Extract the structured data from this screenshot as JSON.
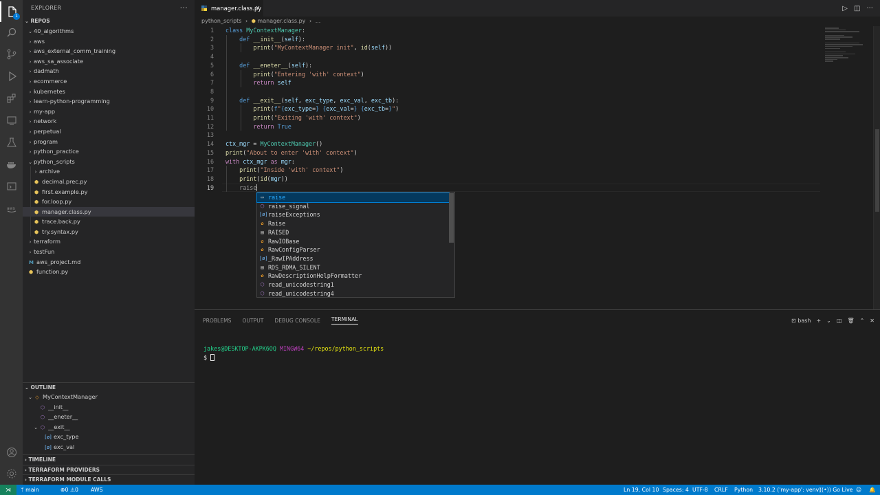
{
  "colors": {
    "accent": "#007acc",
    "remote": "#16825d",
    "selection": "#04395e"
  },
  "sidebar": {
    "title": "EXPLORER",
    "repos_label": "REPOS",
    "tree": [
      {
        "label": "40_algorithms",
        "type": "folder",
        "level": 1,
        "open": true
      },
      {
        "label": "aws",
        "type": "folder",
        "level": 1
      },
      {
        "label": "aws_external_comm_training",
        "type": "folder",
        "level": 1
      },
      {
        "label": "aws_sa_associate",
        "type": "folder",
        "level": 1
      },
      {
        "label": "dadmath",
        "type": "folder",
        "level": 1
      },
      {
        "label": "ecommerce",
        "type": "folder",
        "level": 1
      },
      {
        "label": "kubernetes",
        "type": "folder",
        "level": 1
      },
      {
        "label": "learn-python-programming",
        "type": "folder",
        "level": 1
      },
      {
        "label": "my-app",
        "type": "folder",
        "level": 1
      },
      {
        "label": "network",
        "type": "folder",
        "level": 1
      },
      {
        "label": "perpetual",
        "type": "folder",
        "level": 1
      },
      {
        "label": "program",
        "type": "folder",
        "level": 1
      },
      {
        "label": "python_practice",
        "type": "folder",
        "level": 1
      },
      {
        "label": "python_scripts",
        "type": "folder",
        "level": 1,
        "open": true
      },
      {
        "label": "archive",
        "type": "folder",
        "level": 2
      },
      {
        "label": "decimal.prec.py",
        "type": "py",
        "level": 2
      },
      {
        "label": "first.example.py",
        "type": "py",
        "level": 2
      },
      {
        "label": "for.loop.py",
        "type": "py",
        "level": 2
      },
      {
        "label": "manager.class.py",
        "type": "py",
        "level": 2,
        "selected": true
      },
      {
        "label": "trace.back.py",
        "type": "py",
        "level": 2
      },
      {
        "label": "try.syntax.py",
        "type": "py",
        "level": 2
      },
      {
        "label": "terraform",
        "type": "folder",
        "level": 1
      },
      {
        "label": "testFun",
        "type": "folder",
        "level": 1
      },
      {
        "label": "aws_project.md",
        "type": "md",
        "level": 1
      },
      {
        "label": "function.py",
        "type": "py",
        "level": 1
      }
    ],
    "outline_title": "OUTLINE",
    "outline": [
      {
        "label": "MyContextManager",
        "level": 1,
        "icon": "class",
        "open": true
      },
      {
        "label": "__init__",
        "level": 2,
        "icon": "method"
      },
      {
        "label": "__eneter__",
        "level": 2,
        "icon": "method"
      },
      {
        "label": "__exit__",
        "level": 2,
        "icon": "method",
        "open": true
      },
      {
        "label": "exc_type",
        "level": 3,
        "icon": "variable"
      },
      {
        "label": "exc_val",
        "level": 3,
        "icon": "variable"
      }
    ],
    "timeline": "TIMELINE",
    "terraform_providers": "TERRAFORM PROVIDERS",
    "terraform_module_calls": "TERRAFORM MODULE CALLS"
  },
  "editor": {
    "tab_label": "manager.class.py",
    "breadcrumb": {
      "folder": "python_scripts",
      "file": "manager.class.py",
      "more": "..."
    },
    "line_numbers": [
      "1",
      "2",
      "3",
      "4",
      "5",
      "6",
      "7",
      "8",
      "9",
      "10",
      "11",
      "12",
      "13",
      "14",
      "15",
      "16",
      "17",
      "18",
      "19"
    ],
    "current_line": 19
  },
  "suggest": {
    "items": [
      {
        "label": "raise",
        "icon": "keyword",
        "selected": true
      },
      {
        "label": "raise_signal",
        "icon": "function"
      },
      {
        "label": "raiseExceptions",
        "icon": "variable"
      },
      {
        "label": "Raise",
        "icon": "class"
      },
      {
        "label": "RAISED",
        "icon": "constant"
      },
      {
        "label": "RawIOBase",
        "icon": "class"
      },
      {
        "label": "RawConfigParser",
        "icon": "class"
      },
      {
        "label": "_RawIPAddress",
        "icon": "variable"
      },
      {
        "label": "RDS_RDMA_SILENT",
        "icon": "constant"
      },
      {
        "label": "RawDescriptionHelpFormatter",
        "icon": "class"
      },
      {
        "label": "read_unicodestring1",
        "icon": "function"
      },
      {
        "label": "read_unicodestring4",
        "icon": "function"
      }
    ]
  },
  "panel": {
    "tabs": [
      "PROBLEMS",
      "OUTPUT",
      "DEBUG CONSOLE",
      "TERMINAL"
    ],
    "active_tab": "TERMINAL",
    "shell": "bash",
    "terminal": {
      "user": "jakes@DESKTOP-AKPK6OQ",
      "env": "MINGW64",
      "path": "~/repos/python_scripts",
      "prompt": "$"
    }
  },
  "status": {
    "branch": "main",
    "errors": "0",
    "warnings": "0",
    "aws": "AWS",
    "position": "Ln 19, Col 10",
    "spaces": "Spaces: 4",
    "encoding": "UTF-8",
    "eol": "CRLF",
    "language": "Python",
    "interpreter": "3.10.2 ('my-app': venv)",
    "golive": "Go Live"
  }
}
